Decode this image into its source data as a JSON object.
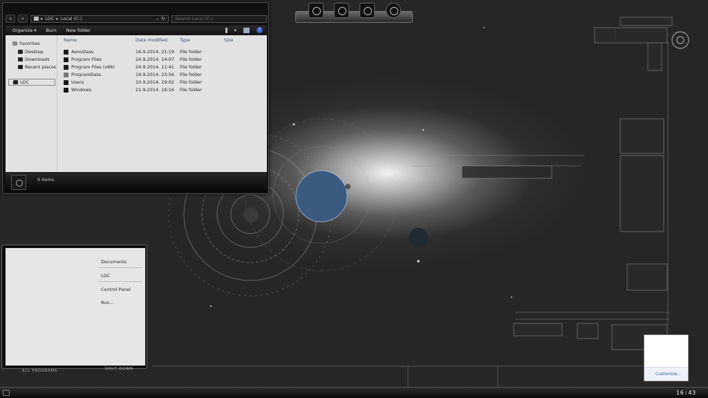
{
  "explorer": {
    "breadcrumb": [
      "LDC",
      "Local (C:)"
    ],
    "breadcrumb_sep": "▸",
    "search_placeholder": "Search Local (C:)",
    "toolbar": {
      "organize": "Organize",
      "organize_caret": "▾",
      "burn": "Burn",
      "new_folder": "New folder",
      "help": "?"
    },
    "nav": {
      "favorites": "Favorites",
      "desktop": "Desktop",
      "downloads": "Downloads",
      "recent": "Recent places",
      "ldc": "LDC"
    },
    "columns": {
      "name": "Name",
      "date": "Date modified",
      "type": "Type",
      "size": "Size"
    },
    "files": [
      {
        "name": "AeroGlass",
        "date": "16.9.2014. 21:19",
        "type": "File folder"
      },
      {
        "name": "Program Files",
        "date": "24.9.2014. 14:07",
        "type": "File folder"
      },
      {
        "name": "Program Files (x86)",
        "date": "24.9.2014. 11:41",
        "type": "File folder"
      },
      {
        "name": "ProgramData",
        "date": "19.9.2014. 23:56",
        "type": "File folder"
      },
      {
        "name": "Users",
        "date": "10.9.2014. 19:02",
        "type": "File folder"
      },
      {
        "name": "Windows",
        "date": "21.9.2014. 16:16",
        "type": "File folder"
      }
    ],
    "status": "6 items"
  },
  "start_menu": {
    "items": [
      "Documents",
      "LDC",
      "Control Panel",
      "Run..."
    ],
    "all_programs": "ALL PROGRAMS",
    "shut_down": "SHUT DOWN"
  },
  "tray": {
    "customize": "Customize..."
  },
  "taskbar": {
    "clock": "16:43"
  },
  "colors": {
    "accent_link": "#2a5db0",
    "help_icon": "#3a66c6"
  }
}
